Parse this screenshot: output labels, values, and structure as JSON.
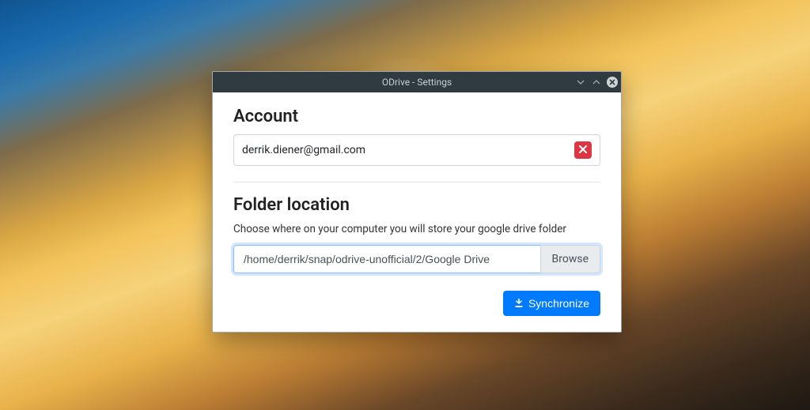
{
  "window": {
    "title": "ODrive - Settings"
  },
  "account": {
    "heading": "Account",
    "email": "derrik.diener@gmail.com"
  },
  "folder": {
    "heading": "Folder location",
    "description": "Choose where on your computer you will store your google drive folder",
    "path": "/home/derrik/snap/odrive-unofficial/2/Google Drive",
    "browse_label": "Browse"
  },
  "actions": {
    "sync_label": "Synchronize"
  }
}
